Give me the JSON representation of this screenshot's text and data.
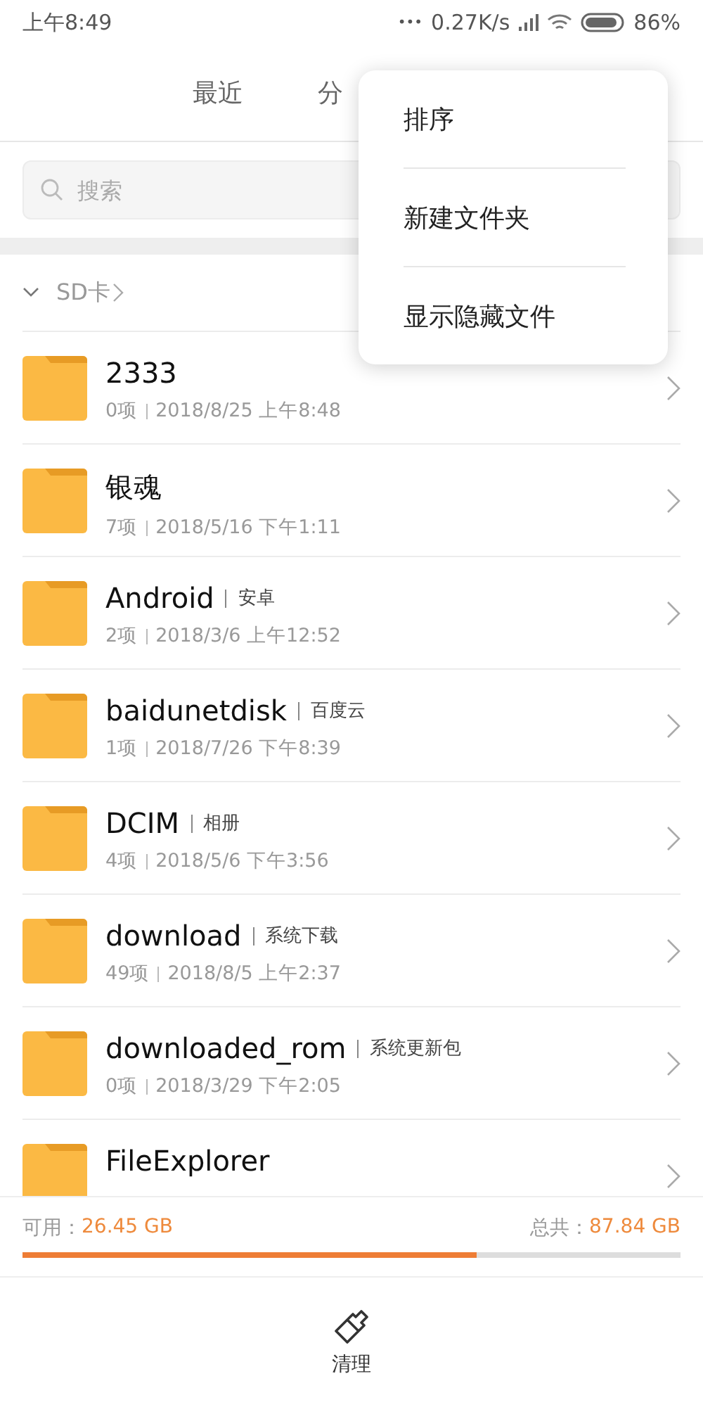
{
  "status_bar": {
    "time": "上午8:49",
    "dots": "•••",
    "speed": "0.27K/s",
    "battery": "86%"
  },
  "tabs": [
    {
      "label": "最近",
      "selected": false
    },
    {
      "label": "分",
      "selected": false
    }
  ],
  "search": {
    "placeholder": "搜索"
  },
  "breadcrumb": {
    "expanded": true,
    "path": "SD卡"
  },
  "folders": [
    {
      "name": "2333",
      "count": "0项",
      "date": "2018/8/25 上午8:48"
    },
    {
      "name": "银魂",
      "count": "7项",
      "date": "2018/5/16 下午1:11"
    },
    {
      "name": "Android",
      "tag": "安卓",
      "count": "2项",
      "date": "2018/3/6 上午12:52"
    },
    {
      "name": "baidunetdisk",
      "tag": "百度云",
      "count": "1项",
      "date": "2018/7/26 下午8:39"
    },
    {
      "name": "DCIM",
      "tag": "相册",
      "count": "4项",
      "date": "2018/5/6 下午3:56"
    },
    {
      "name": "download",
      "tag": "系统下载",
      "count": "49项",
      "date": "2018/8/5 上午2:37"
    },
    {
      "name": "downloaded_rom",
      "tag": "系统更新包",
      "count": "0项",
      "date": "2018/3/29 下午2:05"
    },
    {
      "name": "FileExplorer"
    }
  ],
  "menu": [
    "排序",
    "新建文件夹",
    "显示隐藏文件"
  ],
  "storage": {
    "available_label": "可用：",
    "available": "26.45 GB",
    "total_label": "总共：",
    "total": "87.84 GB",
    "level": 0.69
  },
  "bottom_button": {
    "label": "清理"
  }
}
